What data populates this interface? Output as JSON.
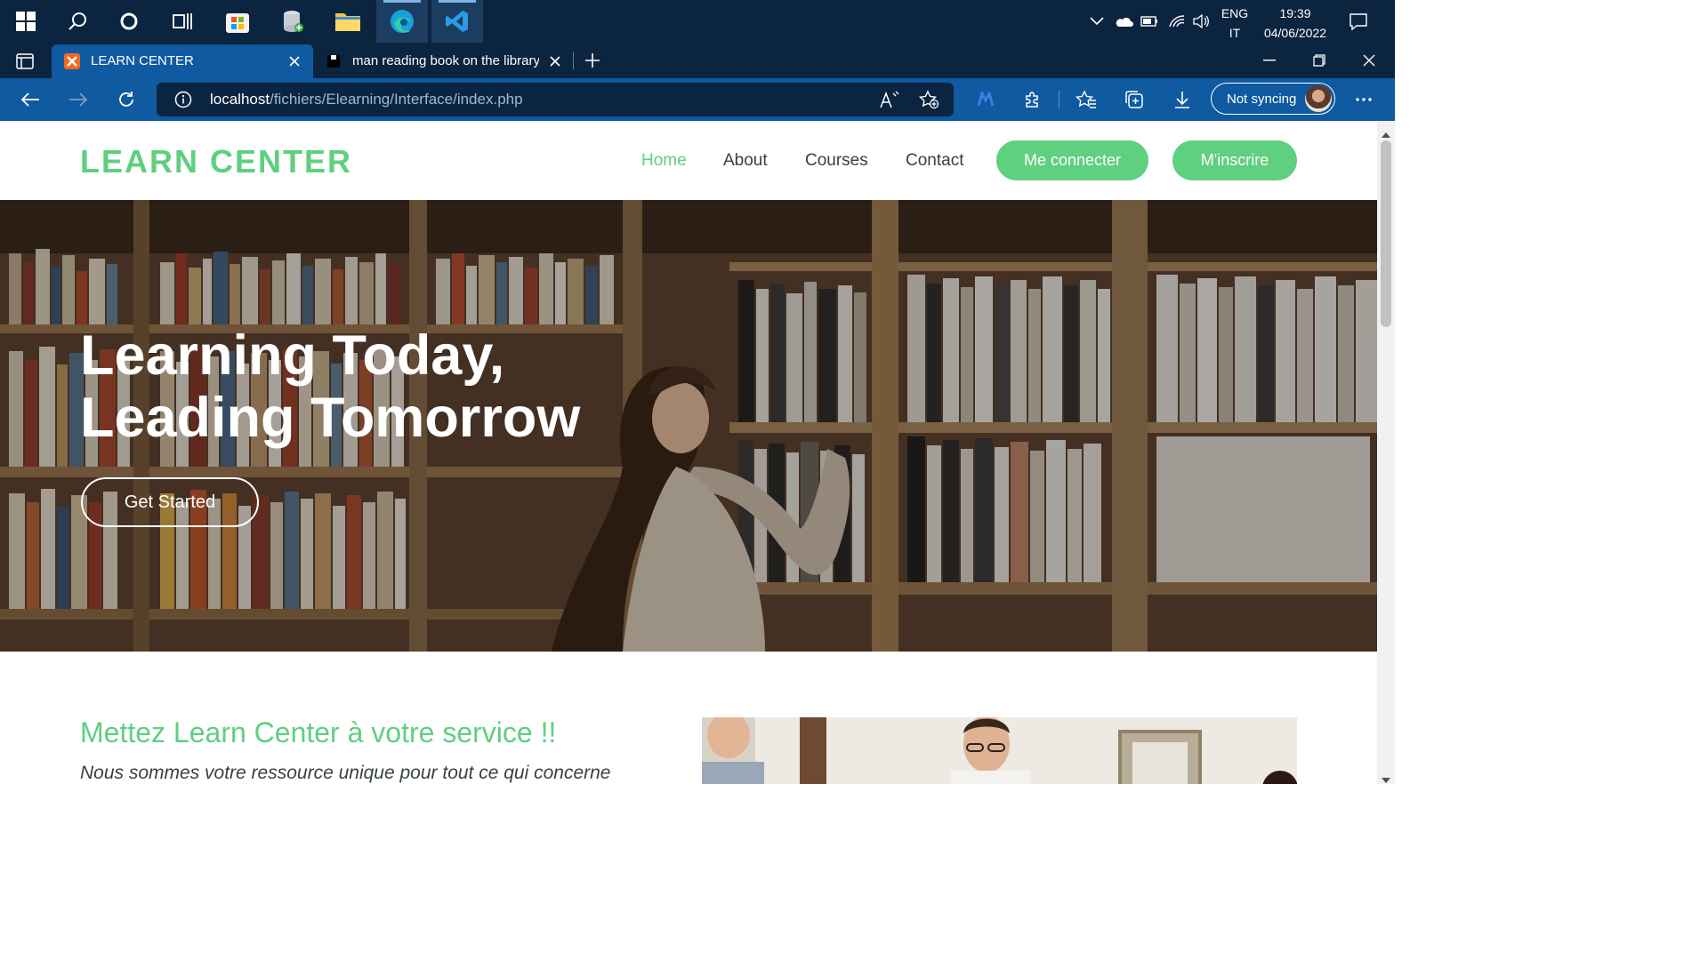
{
  "taskbar": {
    "icons": [
      "windows-start",
      "search",
      "cortana",
      "task-view",
      "microsoft-store",
      "database-app",
      "file-explorer",
      "edge",
      "vscode"
    ],
    "language_line1": "ENG",
    "language_line2": "IT",
    "time": "19:39",
    "date": "04/06/2022"
  },
  "browser": {
    "tabs": [
      {
        "title": "LEARN CENTER",
        "active": true
      },
      {
        "title": "man reading book on the library",
        "active": false
      }
    ],
    "url_host": "localhost",
    "url_path": "/fichiers/Elearning/Interface/index.php",
    "sync_label": "Not syncing"
  },
  "site": {
    "logo": "LEARN CENTER",
    "nav": [
      "Home",
      "About",
      "Courses",
      "Contact"
    ],
    "login_button": "Me connecter",
    "signup_button": "M'inscrire",
    "hero_line1": "Learning Today,",
    "hero_line2": "Leading Tomorrow",
    "hero_button": "Get Started",
    "about_title": "Mettez Learn Center à votre service !!",
    "about_subtitle": "Nous sommes votre ressource unique pour tout ce qui concerne"
  },
  "colors": {
    "accent": "#5fcf80",
    "taskbar": "#0b2440",
    "browser_bar": "#0f5aa0",
    "text": "#37423b"
  }
}
